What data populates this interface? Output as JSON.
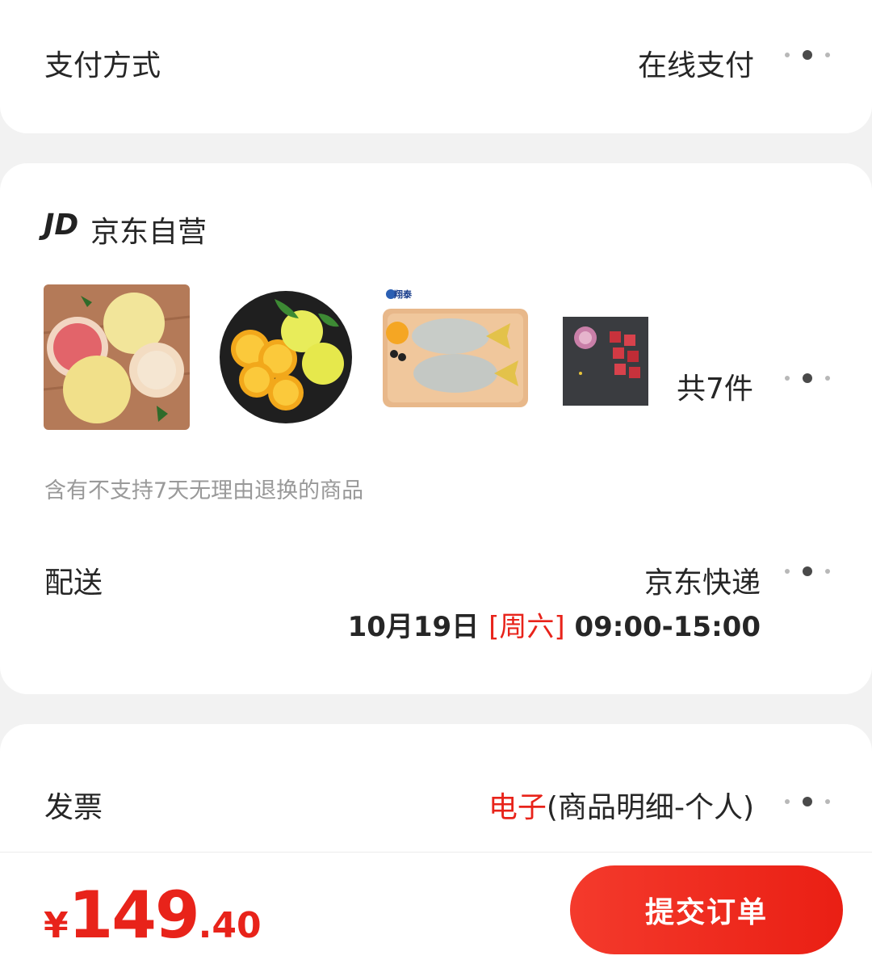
{
  "payment": {
    "label": "支付方式",
    "value": "在线支付"
  },
  "shop": {
    "logo_text": "JD",
    "name": "京东自营",
    "products": [
      {
        "name": "pomelo-image",
        "icon": "pomelo"
      },
      {
        "name": "orange-image",
        "icon": "orange"
      },
      {
        "name": "pompano-fish-image",
        "icon": "fish",
        "brand_badge": "翔泰"
      },
      {
        "name": "diced-meat-image",
        "icon": "meat"
      }
    ],
    "count_label": "共7件",
    "notice": "含有不支持7天无理由退换的商品"
  },
  "delivery": {
    "label": "配送",
    "carrier": "京东快递",
    "date": "10月19日",
    "weekday": "[周六]",
    "time": "09:00-15:00"
  },
  "invoice": {
    "label": "发票",
    "type": "电子",
    "detail": "(商品明细-个人)"
  },
  "footer": {
    "currency": "¥",
    "price_int": "149",
    "price_dec": ".40",
    "submit_label": "提交订单"
  },
  "colors": {
    "accent": "#e8231a",
    "text": "#262626",
    "muted": "#999999",
    "background": "#f2f2f2"
  }
}
